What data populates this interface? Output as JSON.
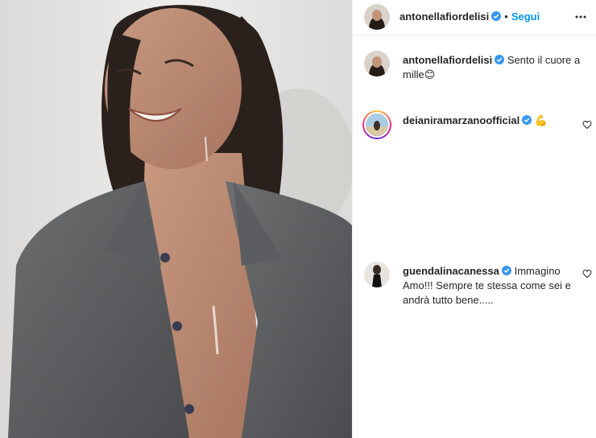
{
  "post": {
    "author": "antonellafiordelisi",
    "follow_label": "Segui",
    "separator": "•",
    "caption_author": "antonellafiordelisi",
    "caption_text": "Sento il cuore a mille😊"
  },
  "comments": [
    {
      "user": "deianiramarzanoofficial",
      "text": "💪"
    },
    {
      "user": "guendalinacanessa",
      "text": "Immagino Amo!!! Sempre te stessa come sei e andrà tutto bene....."
    }
  ],
  "colors": {
    "accent": "#0095f6",
    "verified": "#3897f0",
    "text": "#262626",
    "border": "#efefef"
  },
  "icons": {
    "more": "more-options-icon",
    "verified": "verified-badge-icon",
    "like": "heart-outline-icon"
  }
}
